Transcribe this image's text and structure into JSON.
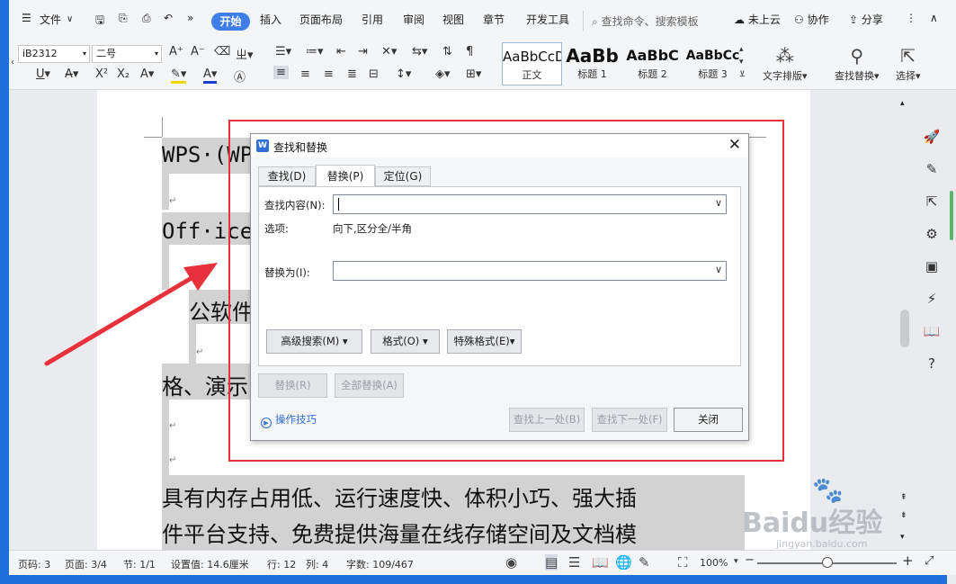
{
  "menubar": {
    "menu_label": "文件",
    "more": "»",
    "tabs": [
      "开始",
      "插入",
      "页面布局",
      "引用",
      "审阅",
      "视图",
      "章节",
      "开发工具"
    ],
    "search_placeholder": "查找命令、搜索模板",
    "cloud": "未上云",
    "collab": "协作",
    "share": "分享"
  },
  "ribbon": {
    "font_name": "iB2312",
    "font_size": "二号",
    "styles": [
      {
        "preview": "AaBbCcDd",
        "label": "正文"
      },
      {
        "preview": "AaBb",
        "label": "标题 1"
      },
      {
        "preview": "AaBbC",
        "label": "标题 2"
      },
      {
        "preview": "AaBbCc",
        "label": "标题 3"
      }
    ],
    "text_layout": "文字排版",
    "find_replace": "查找替换",
    "select": "选择"
  },
  "document": {
    "lines": [
      "WPS·(WPS",
      "Off·ice",
      "公软件",
      "格、演示",
      "具有内存占用低、运行速度快、体积小巧、强大插",
      "件平台支持、免费提供海量在线存储空间及文档模"
    ],
    "para_mark": "↵"
  },
  "dialog": {
    "title": "查找和替换",
    "logo": "W",
    "tabs": [
      "查找(D)",
      "替换(P)",
      "定位(G)"
    ],
    "active_tab": "替换(P)",
    "find_label": "查找内容(N):",
    "find_value": "",
    "options_label": "选项:",
    "options_value": "向下,区分全/半角",
    "replace_label": "替换为(I):",
    "replace_value": "",
    "advanced_search": "高级搜索(M)",
    "format": "格式(O)",
    "special_format": "特殊格式(E)",
    "replace_btn": "替换(R)",
    "replace_all_btn": "全部替换(A)",
    "tips": "操作技巧",
    "find_prev": "查找上一处(B)",
    "find_next": "查找下一处(F)",
    "close": "关闭"
  },
  "statusbar": {
    "page_code": "页码: 3",
    "page": "页面: 3/4",
    "section": "节: 1/1",
    "setting": "设置值: 14.6厘米",
    "row": "行: 12",
    "col": "列: 4",
    "words": "字数: 109/467",
    "zoom": "100%"
  },
  "watermark": {
    "main": "Baidu经验",
    "sub": "jingyan.baidu.com"
  },
  "colors": {
    "accent": "#3f7ee8",
    "annotation_red": "#e8323b",
    "desktop_blue": "#1e6fd9"
  }
}
